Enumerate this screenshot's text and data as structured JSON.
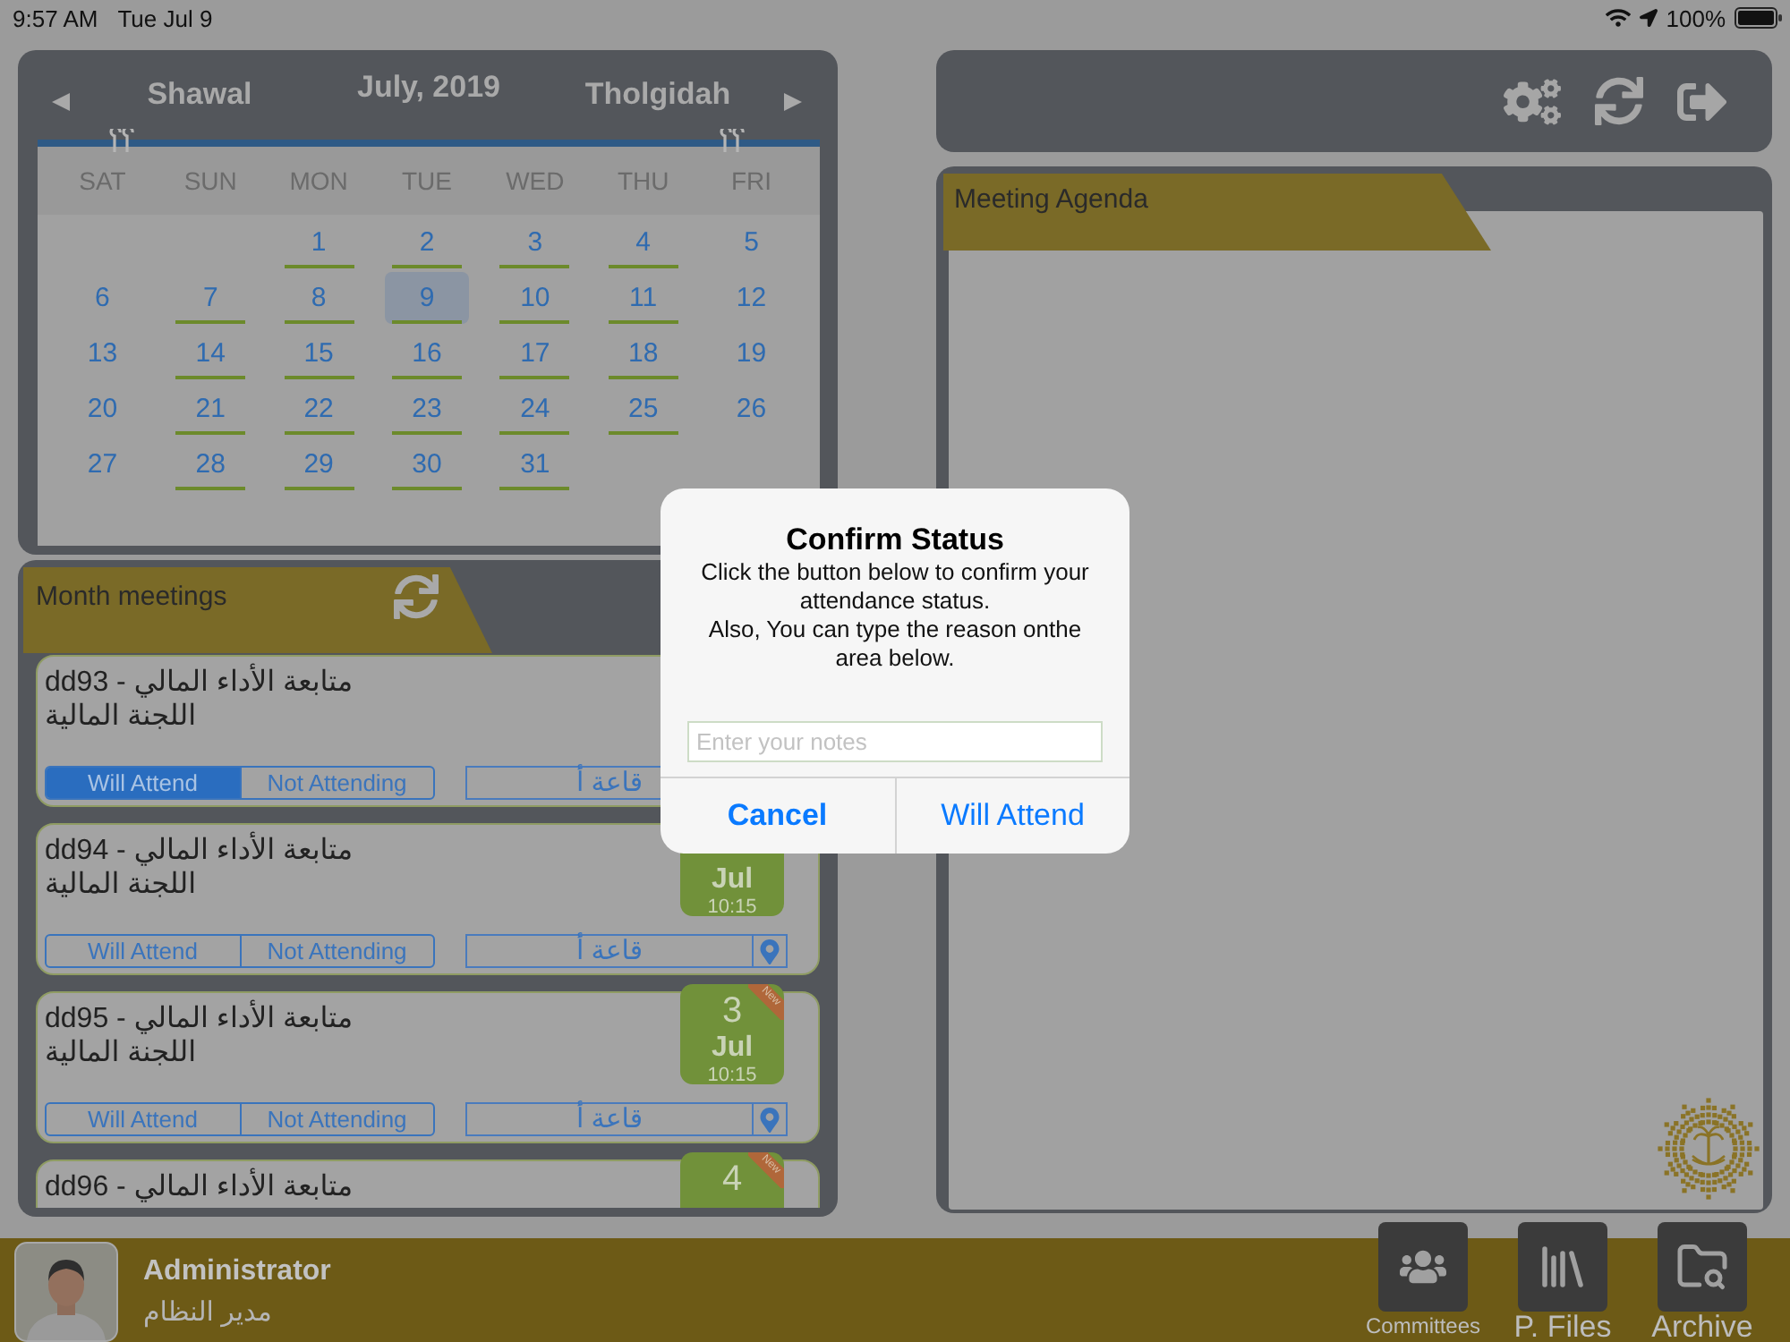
{
  "status_bar": {
    "time": "9:57 AM",
    "date": "Tue Jul 9",
    "battery": "100%"
  },
  "calendar": {
    "prev_month": "Shawal",
    "month": "July, 2019",
    "next_month": "Tholgidah",
    "weekdays": [
      "SAT",
      "SUN",
      "MON",
      "TUE",
      "WED",
      "THU",
      "FRI"
    ],
    "weeks": [
      [
        {
          "day": "1",
          "meeting": true,
          "selected": false
        },
        {
          "day": "2",
          "meeting": true,
          "selected": false
        },
        {
          "day": "3",
          "meeting": true,
          "selected": false
        },
        {
          "day": "4",
          "meeting": true,
          "selected": false
        },
        {
          "day": "5",
          "meeting": false,
          "selected": false
        }
      ],
      [
        {
          "day": "6",
          "meeting": false,
          "selected": false
        },
        {
          "day": "7",
          "meeting": true,
          "selected": false
        },
        {
          "day": "8",
          "meeting": true,
          "selected": false
        },
        {
          "day": "9",
          "meeting": true,
          "selected": true
        },
        {
          "day": "10",
          "meeting": true,
          "selected": false
        },
        {
          "day": "11",
          "meeting": true,
          "selected": false
        },
        {
          "day": "12",
          "meeting": false,
          "selected": false
        }
      ],
      [
        {
          "day": "13",
          "meeting": false,
          "selected": false
        },
        {
          "day": "14",
          "meeting": true,
          "selected": false
        },
        {
          "day": "15",
          "meeting": true,
          "selected": false
        },
        {
          "day": "16",
          "meeting": true,
          "selected": false
        },
        {
          "day": "17",
          "meeting": true,
          "selected": false
        },
        {
          "day": "18",
          "meeting": true,
          "selected": false
        },
        {
          "day": "19",
          "meeting": false,
          "selected": false
        }
      ],
      [
        {
          "day": "20",
          "meeting": false,
          "selected": false
        },
        {
          "day": "21",
          "meeting": true,
          "selected": false
        },
        {
          "day": "22",
          "meeting": true,
          "selected": false
        },
        {
          "day": "23",
          "meeting": true,
          "selected": false
        },
        {
          "day": "24",
          "meeting": true,
          "selected": false
        },
        {
          "day": "25",
          "meeting": true,
          "selected": false
        },
        {
          "day": "26",
          "meeting": false,
          "selected": false
        }
      ],
      [
        {
          "day": "27",
          "meeting": false,
          "selected": false
        },
        {
          "day": "28",
          "meeting": true,
          "selected": false
        },
        {
          "day": "29",
          "meeting": true,
          "selected": false
        },
        {
          "day": "30",
          "meeting": true,
          "selected": false
        },
        {
          "day": "31",
          "meeting": true,
          "selected": false
        }
      ]
    ]
  },
  "month_meetings": {
    "title": "Month meetings",
    "meetings": [
      {
        "title": "dd93 - متابعة الأداء المالي",
        "committee": "اللجنة المالية",
        "attendance": [
          {
            "label": "Will Attend",
            "selected": true
          },
          {
            "label": "Not Attending",
            "selected": false
          }
        ],
        "location": "قاعة أ"
      },
      {
        "title": "dd94 - متابعة الأداء المالي",
        "committee": "اللجنة المالية",
        "attendance": [
          {
            "label": "Will Attend",
            "selected": false
          },
          {
            "label": "Not Attending",
            "selected": false
          }
        ],
        "location": "قاعة أ",
        "date": {
          "month": "Jul",
          "time": "10:15"
        }
      },
      {
        "title": "dd95 - متابعة الأداء المالي",
        "committee": "اللجنة المالية",
        "attendance": [
          {
            "label": "Will Attend",
            "selected": false
          },
          {
            "label": "Not Attending",
            "selected": false
          }
        ],
        "location": "قاعة أ",
        "date": {
          "day": "3",
          "month": "Jul",
          "time": "10:15",
          "ribbon": "New"
        }
      },
      {
        "title": "dd96 - متابعة الأداء المالي",
        "date": {
          "day": "4",
          "ribbon": "New"
        }
      }
    ]
  },
  "meeting_agenda": {
    "title": "Meeting Agenda"
  },
  "user": {
    "name": "Administrator",
    "role": "مدير النظام"
  },
  "nav": [
    {
      "label": "Committees"
    },
    {
      "label": "P. Files"
    },
    {
      "label": "Archive"
    }
  ],
  "dialog": {
    "title": "Confirm Status",
    "message": [
      "Click the button below to confirm your attendance status.",
      "Also, You can type the reason onthe area below."
    ],
    "placeholder": "Enter your notes",
    "buttons": [
      {
        "label": "Cancel",
        "kind": "cancel"
      },
      {
        "label": "Will Attend",
        "kind": "confirm"
      }
    ]
  }
}
